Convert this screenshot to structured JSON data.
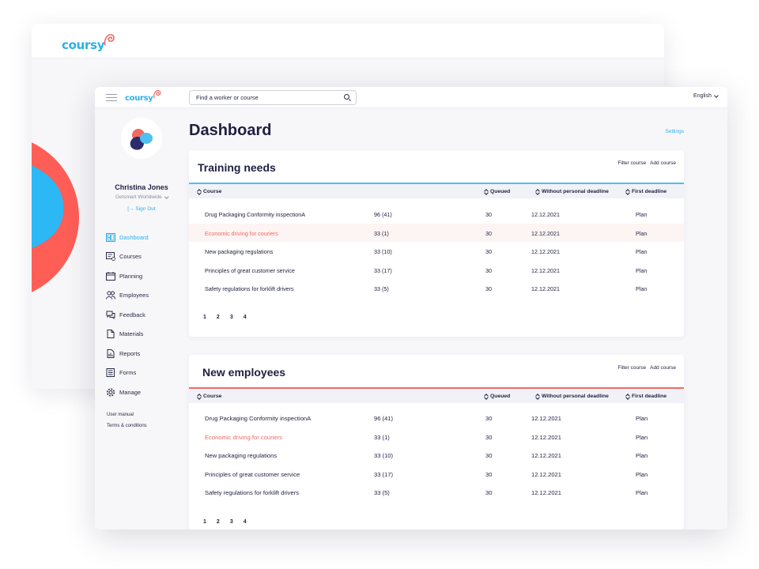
{
  "brand": {
    "name": "coursy",
    "blue": "#2bb0e8",
    "red": "#ef6a62",
    "navy": "#1f2040"
  },
  "topbar": {
    "search_placeholder": "Find a worker or course",
    "language": "English"
  },
  "user": {
    "name": "Christina Jones",
    "org": "Getsmart Worldwide",
    "signout": "Sign Out"
  },
  "sidebar": {
    "items": [
      {
        "label": "Dashboard",
        "icon": "dashboard-icon",
        "active": true
      },
      {
        "label": "Courses",
        "icon": "courses-icon"
      },
      {
        "label": "Planning",
        "icon": "calendar-icon"
      },
      {
        "label": "Employees",
        "icon": "users-icon"
      },
      {
        "label": "Feedback",
        "icon": "chat-icon"
      },
      {
        "label": "Materials",
        "icon": "document-icon"
      },
      {
        "label": "Reports",
        "icon": "chart-icon"
      },
      {
        "label": "Forms",
        "icon": "form-icon"
      },
      {
        "label": "Manage",
        "icon": "gear-icon"
      }
    ],
    "links": [
      "User manual",
      "Terms & conditions"
    ]
  },
  "main": {
    "title": "Dashboard",
    "settings": "Settings",
    "columns": {
      "course": "Course",
      "queued": "Queued",
      "without_deadline": "Without personal deadline",
      "first_deadline": "First deadline"
    },
    "cards": [
      {
        "title": "Training needs",
        "filter": "Filter course",
        "add": "Add course",
        "rows": [
          {
            "course": "Drug Packaging Conformity inspectionA",
            "count": "96  (41)",
            "queued": "30",
            "date": "12.12.2021",
            "deadline": "Plan"
          },
          {
            "course": "Economic driving for couriers",
            "count": "33  (1)",
            "queued": "30",
            "date": "12.12.2021",
            "deadline": "Plan"
          },
          {
            "course": "New packaging regulations",
            "count": "33  (10)",
            "queued": "30",
            "date": "12.12.2021",
            "deadline": "Plan"
          },
          {
            "course": "Principles of great customer service",
            "count": "33  (17)",
            "queued": "30",
            "date": "12.12.2021",
            "deadline": "Plan"
          },
          {
            "course": "Safety regulations for forklift drivers",
            "count": "33  (5)",
            "queued": "30",
            "date": "12.12.2021",
            "deadline": "Plan"
          }
        ],
        "pages": [
          "1",
          "2",
          "3",
          "4"
        ]
      },
      {
        "title": "New employees",
        "filter": "Filter course",
        "add": "Add course",
        "rows": [
          {
            "course": "Drug Packaging Conformity inspectionA",
            "count": "96 (41)",
            "queued": "30",
            "date": "12.12.2021",
            "deadline": "Plan"
          },
          {
            "course": "Economic driving for couriers",
            "count": "33 (1)",
            "queued": "30",
            "date": "12.12.2021",
            "deadline": "Plan"
          },
          {
            "course": "New packaging regulations",
            "count": "33 (10)",
            "queued": "30",
            "date": "12.12.2021",
            "deadline": "Plan"
          },
          {
            "course": "Principles of great customer service",
            "count": "33 (17)",
            "queued": "30",
            "date": "12.12.2021",
            "deadline": "Plan"
          },
          {
            "course": "Safety regulations for forklift drivers",
            "count": "33 (5)",
            "queued": "30",
            "date": "12.12.2021",
            "deadline": "Plan"
          }
        ],
        "pages": [
          "1",
          "2",
          "3",
          "4"
        ]
      }
    ]
  }
}
